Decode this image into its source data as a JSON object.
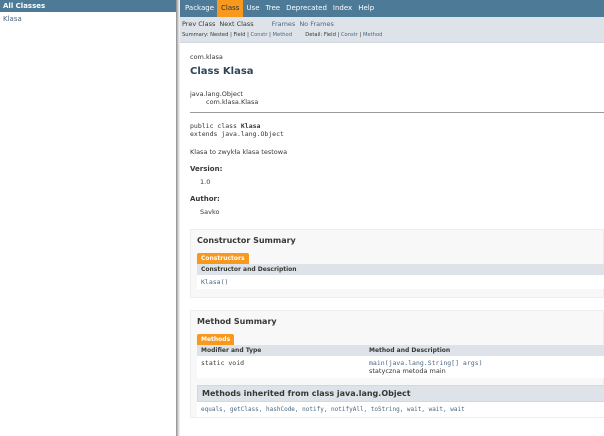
{
  "left_frame": {
    "heading": "All Classes",
    "classes": [
      "Klasa"
    ]
  },
  "navbar": {
    "items": [
      "Package",
      "Class",
      "Use",
      "Tree",
      "Deprecated",
      "Index",
      "Help"
    ],
    "active": "Class"
  },
  "subnav": {
    "prev": "Prev Class",
    "next": "Next Class",
    "frames": "Frames",
    "no_frames": "No Frames",
    "summary_label": "Summary:",
    "summary_nested": "Nested",
    "summary_field": "Field",
    "summary_constr": "Constr",
    "summary_method": "Method",
    "detail_label": "Detail:",
    "detail_field": "Field",
    "detail_constr": "Constr",
    "detail_method": "Method",
    "sep": "|"
  },
  "header": {
    "package": "com.klasa",
    "title": "Class Klasa"
  },
  "inheritance": {
    "parent": "java.lang.Object",
    "child": "com.klasa.Klasa"
  },
  "declaration": {
    "prefix": "public class ",
    "name": "Klasa",
    "extends": "extends java.lang.Object"
  },
  "description": "Klasa to zwykła klasa testowa",
  "tags": {
    "version_label": "Version:",
    "version_value": "1.0",
    "author_label": "Author:",
    "author_value": "Savko"
  },
  "constructor_summary": {
    "title": "Constructor Summary",
    "caption": "Constructors",
    "column": "Constructor and Description",
    "rows": [
      {
        "signature": "Klasa()"
      }
    ]
  },
  "method_summary": {
    "title": "Method Summary",
    "caption": "Methods",
    "columns": [
      "Modifier and Type",
      "Method and Description"
    ],
    "rows": [
      {
        "modifier": "static void",
        "method": "main(java.lang.String[] args)",
        "description": "statyczna metoda main"
      }
    ],
    "inherited_title": "Methods inherited from class java.lang.Object",
    "inherited_methods": "equals, getClass, hashCode, notify, notifyAll, toString, wait, wait, wait"
  }
}
